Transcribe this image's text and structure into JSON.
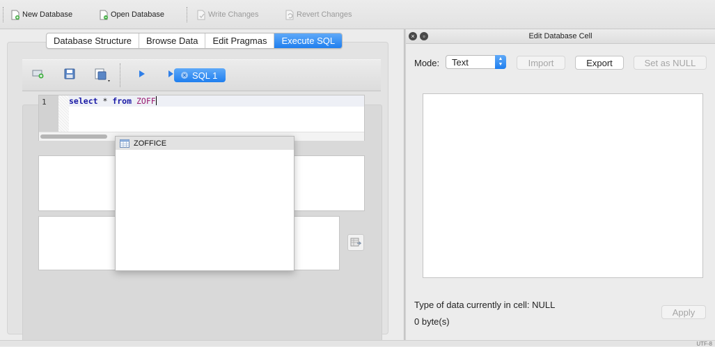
{
  "toolbar": {
    "new_database": "New Database",
    "open_database": "Open Database",
    "write_changes": "Write Changes",
    "revert_changes": "Revert Changes"
  },
  "tabs": [
    {
      "label": "Database Structure",
      "active": false
    },
    {
      "label": "Browse Data",
      "active": false
    },
    {
      "label": "Edit Pragmas",
      "active": false
    },
    {
      "label": "Execute SQL",
      "active": true
    }
  ],
  "sql_tab": {
    "label": "SQL 1"
  },
  "editor": {
    "line_number": "1",
    "kw_select": "select",
    "op_star": " * ",
    "kw_from": "from",
    "space": " ",
    "ident": "ZOFF"
  },
  "autocomplete": {
    "items": [
      "ZOFFICE"
    ]
  },
  "edit_cell": {
    "title": "Edit Database Cell",
    "mode_label": "Mode:",
    "mode_value": "Text",
    "import": "Import",
    "export": "Export",
    "set_null": "Set as NULL",
    "type_info": "Type of data currently in cell: NULL",
    "size_info": "0 byte(s)",
    "apply": "Apply"
  },
  "status": {
    "encoding": "UTF-8"
  },
  "colors": {
    "accent": "#1f7fef",
    "keyword": "#1a1aa6",
    "identifier": "#9a1a70"
  }
}
